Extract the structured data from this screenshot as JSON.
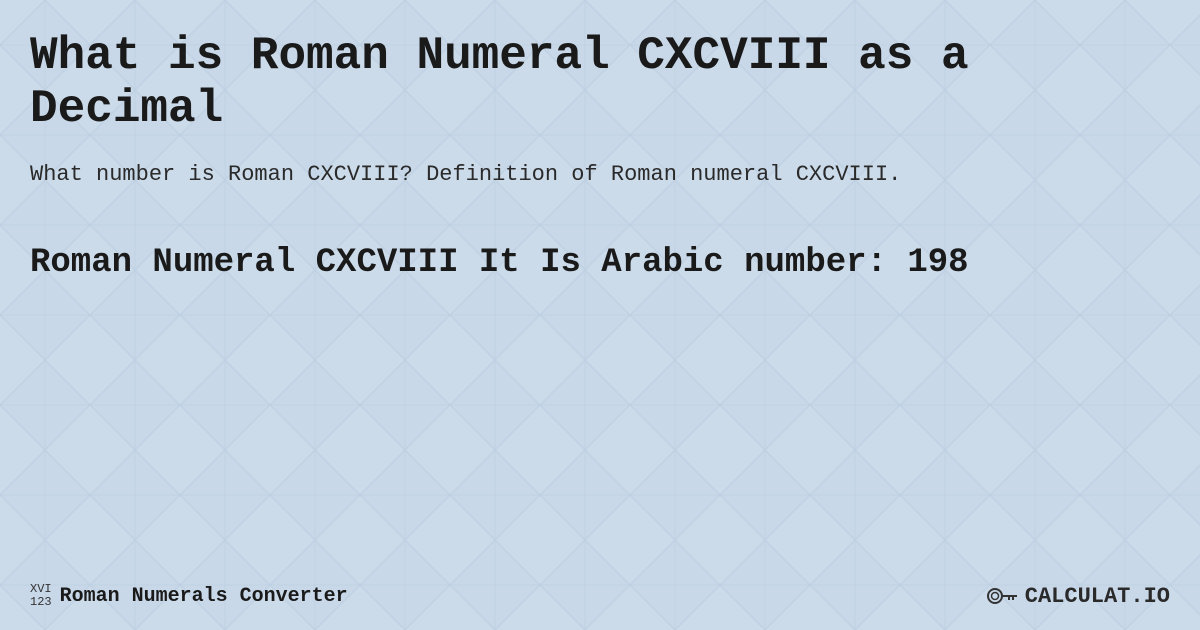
{
  "page": {
    "background_color": "#c5d5e5",
    "pattern_color": "#b8cad8",
    "pattern_color2": "#d0e0ef"
  },
  "header": {
    "title": "What is Roman Numeral CXCVIII as a Decimal"
  },
  "description": {
    "text": "What number is Roman CXCVIII? Definition of Roman numeral CXCVIII."
  },
  "result": {
    "text": "Roman Numeral CXCVIII It Is  Arabic number: 198"
  },
  "footer": {
    "logo_top": "XVI",
    "logo_bottom": "123",
    "logo_label": "Roman Numerals Converter",
    "brand": "CALCULAT.IO"
  }
}
